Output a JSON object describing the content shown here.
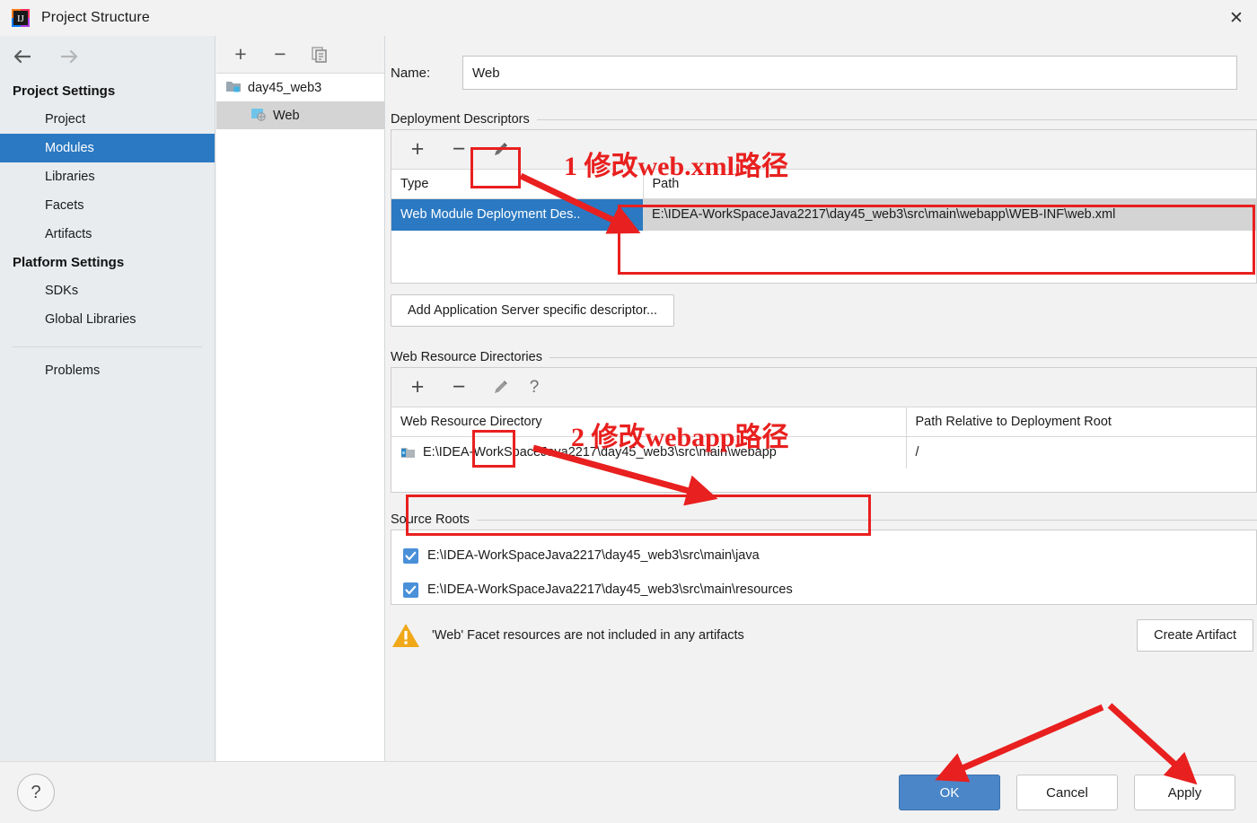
{
  "window": {
    "title": "Project Structure",
    "close_label": "✕",
    "logo_icon": "intellij-idea-logo-icon"
  },
  "sidebar": {
    "back_icon": "arrow-left-icon",
    "forward_icon": "arrow-right-icon",
    "sections": [
      {
        "heading": "Project Settings",
        "items": [
          {
            "label": "Project",
            "selected": false
          },
          {
            "label": "Modules",
            "selected": true
          },
          {
            "label": "Libraries",
            "selected": false
          },
          {
            "label": "Facets",
            "selected": false
          },
          {
            "label": "Artifacts",
            "selected": false
          }
        ]
      },
      {
        "heading": "Platform Settings",
        "items": [
          {
            "label": "SDKs",
            "selected": false
          },
          {
            "label": "Global Libraries",
            "selected": false
          }
        ]
      }
    ],
    "problems_label": "Problems"
  },
  "tree": {
    "toolbar": {
      "add_label": "+",
      "remove_label": "−",
      "copy_icon": "copy-icon"
    },
    "nodes": [
      {
        "label": "day45_web3",
        "icon": "module-folder-icon",
        "level": 0,
        "selected": false
      },
      {
        "label": "Web",
        "icon": "web-facet-icon",
        "level": 1,
        "selected": true
      }
    ]
  },
  "main": {
    "name_label": "Name:",
    "name_value": "Web",
    "deployment_descriptors": {
      "group_title": "Deployment Descriptors",
      "toolbar": {
        "add_label": "+",
        "remove_label": "−",
        "edit_icon": "pencil-edit-icon"
      },
      "columns": [
        "Type",
        "Path"
      ],
      "rows": [
        {
          "type": "Web Module Deployment Des..",
          "path": "E:\\IDEA-WorkSpaceJava2217\\day45_web3\\src\\main\\webapp\\WEB-INF\\web.xml",
          "selected": true
        }
      ],
      "add_descriptor_button": "Add Application Server specific descriptor..."
    },
    "web_resource_directories": {
      "group_title": "Web Resource Directories",
      "toolbar": {
        "add_label": "+",
        "remove_label": "−",
        "edit_icon": "pencil-edit-icon",
        "help_label": "?"
      },
      "columns": [
        "Web Resource Directory",
        "Path Relative to Deployment Root"
      ],
      "rows": [
        {
          "directory": "E:\\IDEA-WorkSpaceJava2217\\day45_web3\\src\\main\\webapp",
          "relative_path": "/",
          "icon": "folder-resource-icon"
        }
      ]
    },
    "source_roots": {
      "group_title": "Source Roots",
      "rows": [
        {
          "path": "E:\\IDEA-WorkSpaceJava2217\\day45_web3\\src\\main\\java",
          "checked": true
        },
        {
          "path": "E:\\IDEA-WorkSpaceJava2217\\day45_web3\\src\\main\\resources",
          "checked": true
        }
      ]
    },
    "warning": {
      "icon": "warning-triangle-icon",
      "text": "'Web' Facet resources are not included in any artifacts",
      "action_button": "Create Artifact"
    }
  },
  "footer": {
    "help_label": "?",
    "ok_label": "OK",
    "cancel_label": "Cancel",
    "apply_label": "Apply"
  },
  "annotations": {
    "accent_color": "#e8201f",
    "items": [
      {
        "text": "1  修改web.xml路径"
      },
      {
        "text": "2  修改webapp路径"
      }
    ]
  }
}
